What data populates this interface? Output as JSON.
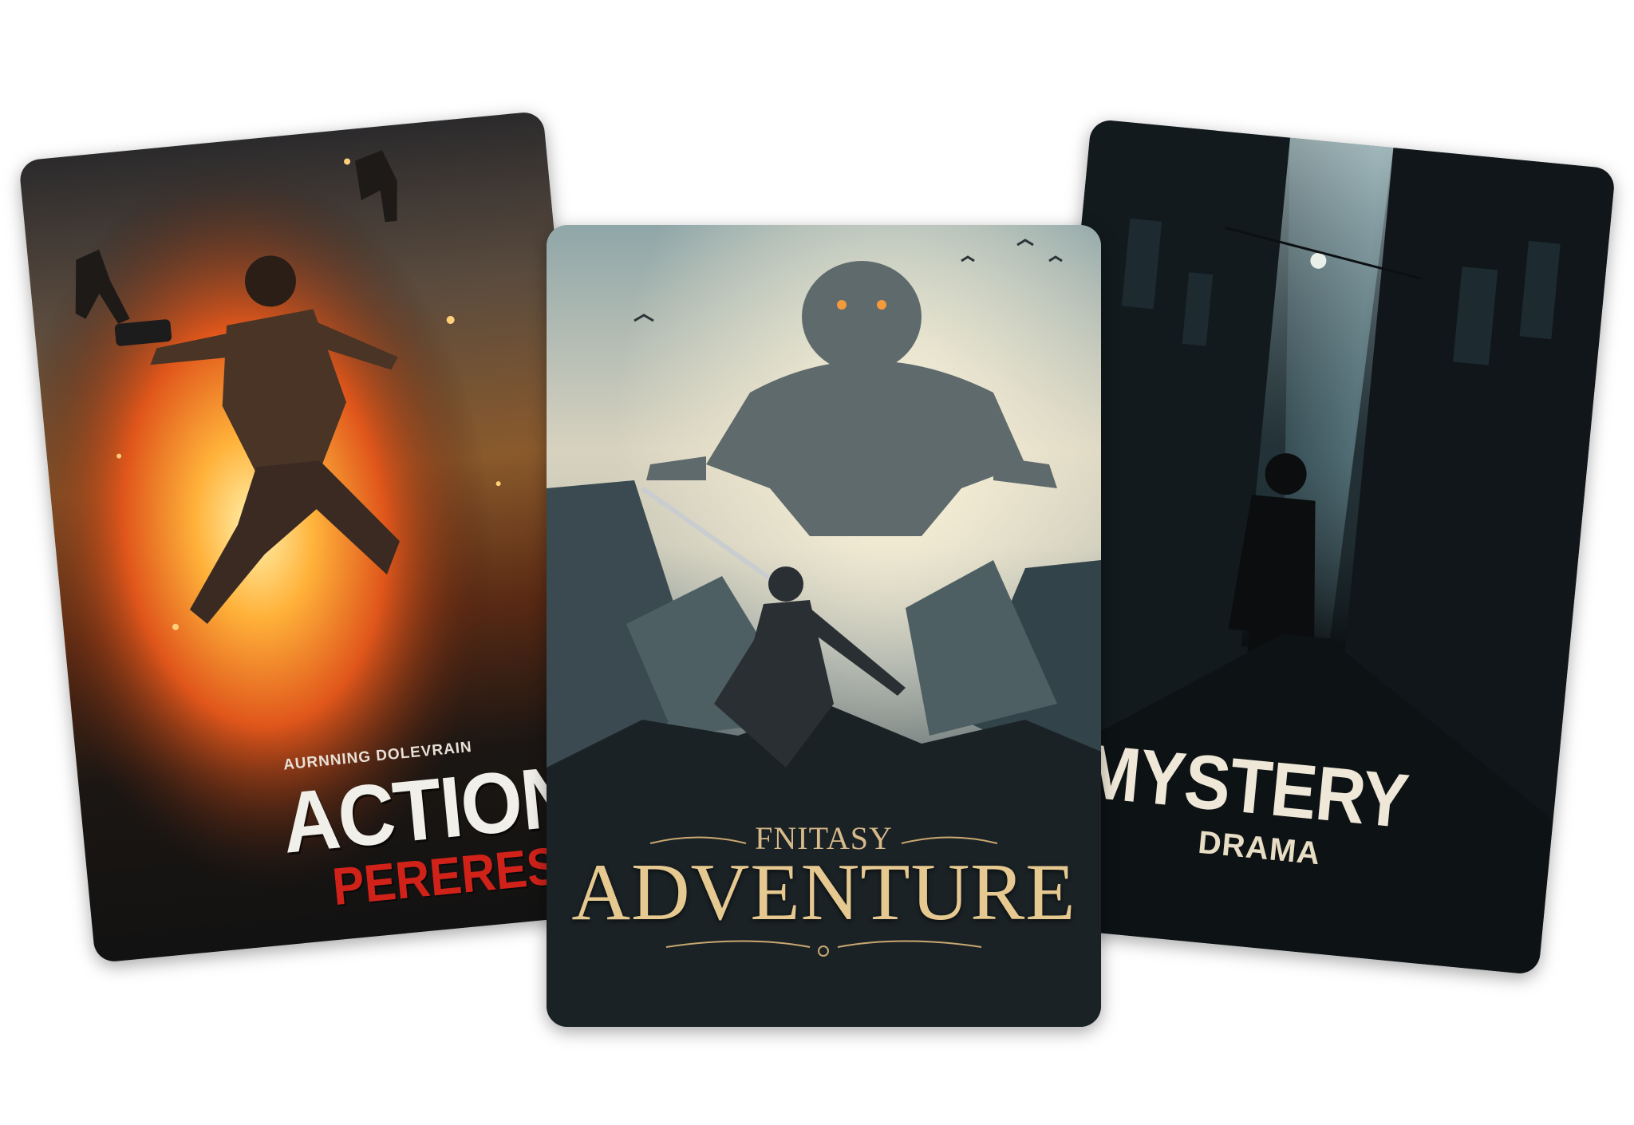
{
  "cards": {
    "action": {
      "tagline": "AURNNING DOLEVRAIN",
      "title": "ACTION",
      "subtitle": "PERERES",
      "accent": "#d1221a"
    },
    "adventure": {
      "kicker": "FNITASY",
      "title": "ADVENTURE",
      "accent": "#e6c990"
    },
    "mystery": {
      "title": "MYSTERY",
      "subtitle": "DRAMA",
      "accent": "#efe8d8"
    }
  }
}
